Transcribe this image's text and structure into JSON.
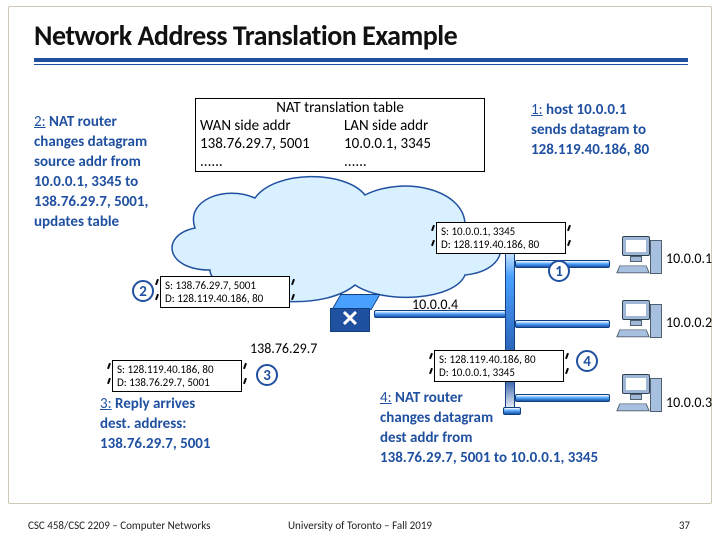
{
  "slide": {
    "title": "Network Address Translation Example"
  },
  "nat_table": {
    "title": "NAT translation table",
    "headers": {
      "wan": "WAN side addr",
      "lan": "LAN side addr"
    },
    "rows": [
      {
        "wan": "138.76.29.7, 5001",
        "lan": "10.0.0.1, 3345"
      },
      {
        "wan": "......",
        "lan": "......"
      }
    ]
  },
  "callouts": {
    "step1": {
      "lead": "1:",
      "text1": " host 10.0.0.1",
      "text2": "sends datagram to",
      "text3": "128.119.40.186, 80"
    },
    "step2": {
      "lead": "2:",
      "text1": " NAT router",
      "text2": "changes datagram",
      "text3": "source addr from",
      "text4": "10.0.0.1, 3345 to",
      "text5": "138.76.29.7, 5001,",
      "text6": "updates table"
    },
    "step3": {
      "lead": "3:",
      "text1": " Reply arrives",
      "text2": "dest. address:",
      "text3": "138.76.29.7, 5001"
    },
    "step4": {
      "lead": "4:",
      "text1": " NAT router",
      "text2": "changes datagram",
      "text3": "dest addr from",
      "text4": "138.76.29.7, 5001 to 10.0.0.1, 3345"
    }
  },
  "packets": {
    "p1": {
      "src": "S: 10.0.0.1, 3345",
      "dst": "D: 128.119.40.186, 80"
    },
    "p2": {
      "src": "S: 138.76.29.7, 5001",
      "dst": "D: 128.119.40.186, 80"
    },
    "p3": {
      "src": "S: 128.119.40.186, 80",
      "dst": "D: 138.76.29.7, 5001"
    },
    "p4": {
      "src": "S: 128.119.40.186, 80",
      "dst": "D: 10.0.0.1, 3345"
    }
  },
  "labels": {
    "router_ip": "138.76.29.7",
    "subnet_ip": "10.0.0.4",
    "host1": "10.0.0.1",
    "host2": "10.0.0.2",
    "host3": "10.0.0.3"
  },
  "numbers": {
    "n1": "1",
    "n2": "2",
    "n3": "3",
    "n4": "4"
  },
  "footer": {
    "left": "CSC 458/CSC 2209 – Computer Networks",
    "center": "University of Toronto – Fall 2019",
    "right": "37"
  }
}
